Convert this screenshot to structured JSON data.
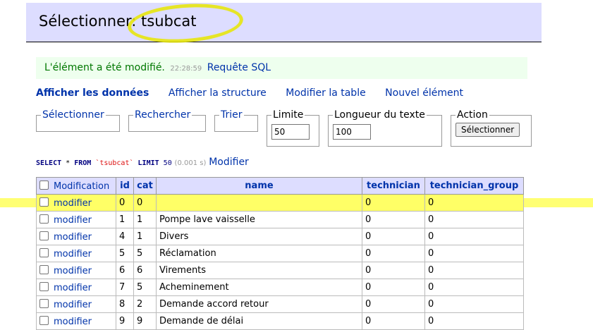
{
  "header": {
    "title": "Sélectionner: tsubcat"
  },
  "message": {
    "text": "L'élément a été modifié.",
    "time": "22:28:59",
    "link": "Requête SQL"
  },
  "nav": [
    {
      "label": "Afficher les données",
      "active": true
    },
    {
      "label": "Afficher la structure"
    },
    {
      "label": "Modifier la table"
    },
    {
      "label": "Nouvel élément"
    }
  ],
  "form": {
    "select_label": "Sélectionner",
    "search_label": "Rechercher",
    "sort_label": "Trier",
    "limit_label": "Limite",
    "limit_value": "50",
    "text_length_label": "Longueur du texte",
    "text_length_value": "100",
    "action_label": "Action",
    "action_button": "Sélectionner"
  },
  "sql": {
    "kw_select": "SELECT",
    "star": " * ",
    "kw_from": "FROM",
    "table": "`tsubcat`",
    "kw_limit": "LIMIT",
    "limit": "50",
    "time": "(0.001 s)",
    "edit_link": "Modifier"
  },
  "table": {
    "headers": [
      "Modification",
      "id",
      "cat",
      "name",
      "technician",
      "technician_group"
    ],
    "edit_label": "modifier",
    "rows": [
      {
        "id": "0",
        "cat": "0",
        "name": "",
        "technician": "0",
        "technician_group": "0",
        "highlight": true
      },
      {
        "id": "1",
        "cat": "1",
        "name": "Pompe lave vaisselle",
        "technician": "0",
        "technician_group": "0"
      },
      {
        "id": "4",
        "cat": "1",
        "name": "Divers",
        "technician": "0",
        "technician_group": "0"
      },
      {
        "id": "5",
        "cat": "5",
        "name": "Réclamation",
        "technician": "0",
        "technician_group": "0"
      },
      {
        "id": "6",
        "cat": "6",
        "name": "Virements",
        "technician": "0",
        "technician_group": "0"
      },
      {
        "id": "7",
        "cat": "5",
        "name": "Acheminement",
        "technician": "0",
        "technician_group": "0"
      },
      {
        "id": "8",
        "cat": "2",
        "name": "Demande accord retour",
        "technician": "0",
        "technician_group": "0"
      },
      {
        "id": "9",
        "cat": "9",
        "name": "Demande de délai",
        "technician": "0",
        "technician_group": "0"
      }
    ]
  },
  "colors": {
    "header_bg": "#ddddff",
    "link": "#0033aa",
    "message_bg": "#eeffee",
    "highlight": "#ffff00"
  }
}
